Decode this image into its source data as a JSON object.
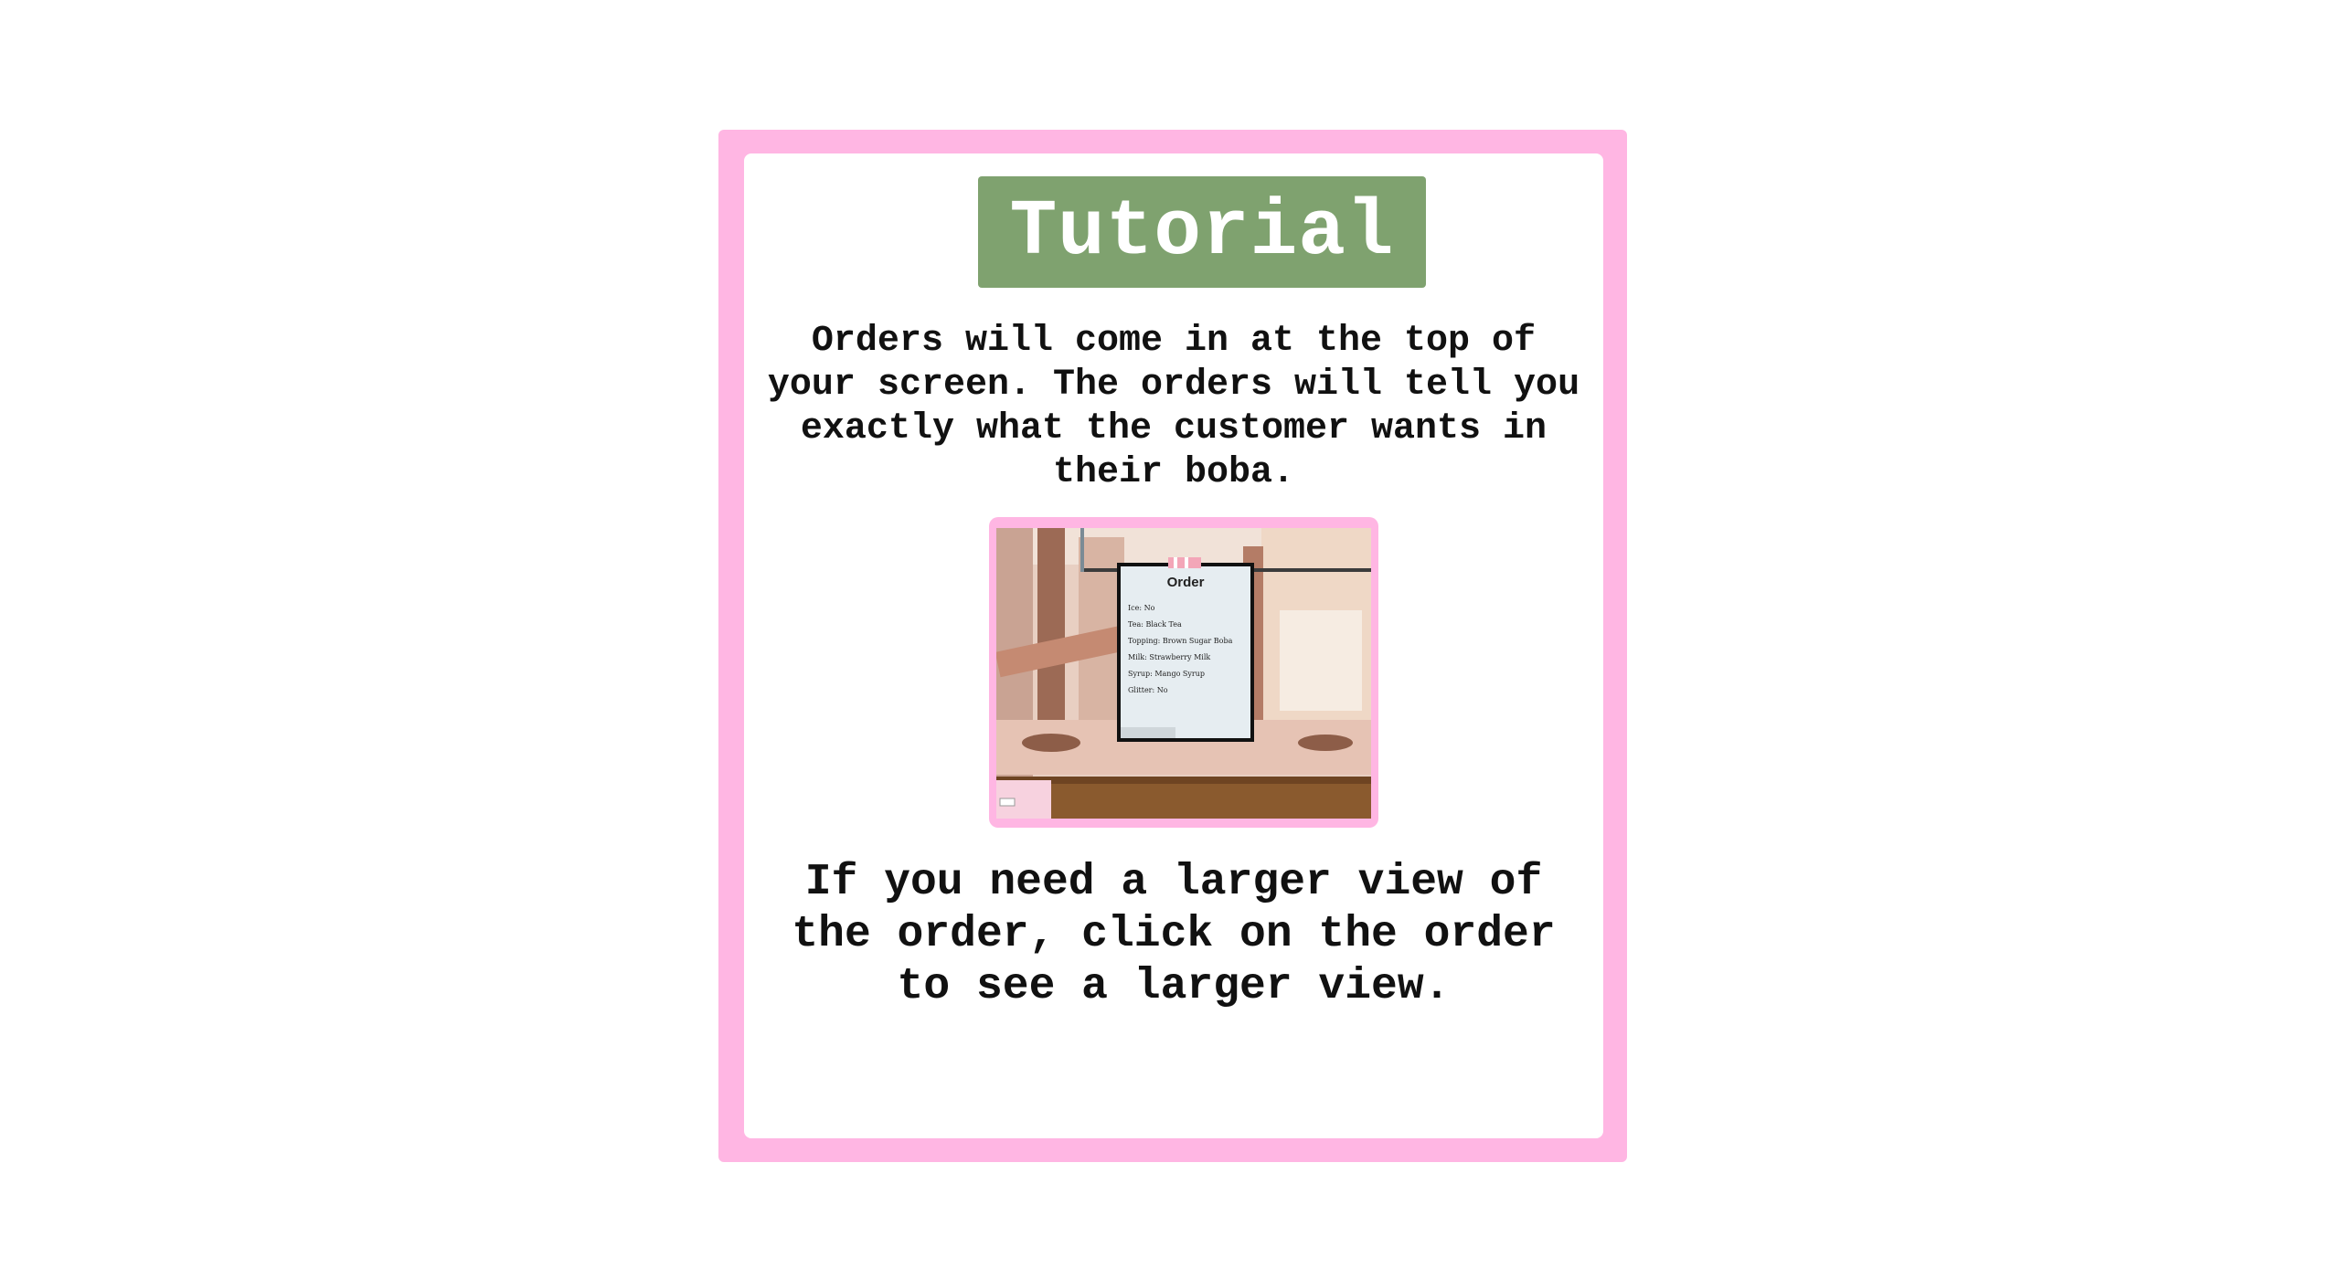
{
  "tutorial": {
    "title": "Tutorial",
    "intro": "Orders will come in at the top of your screen. The orders will tell you exactly what the customer wants in their boba.",
    "note": "If you need a larger view of the order, click on the order to see a larger view."
  },
  "order_ticket": {
    "heading": "Order",
    "lines": [
      "Ice: No",
      "Tea: Black Tea",
      "Topping: Brown Sugar Boba",
      "Milk: Strawberry Milk",
      "Syrup: Mango Syrup",
      "Glitter: No"
    ]
  },
  "colors": {
    "frame": "#ffb6e3",
    "title_badge": "#7fa26f",
    "text": "#111111"
  }
}
